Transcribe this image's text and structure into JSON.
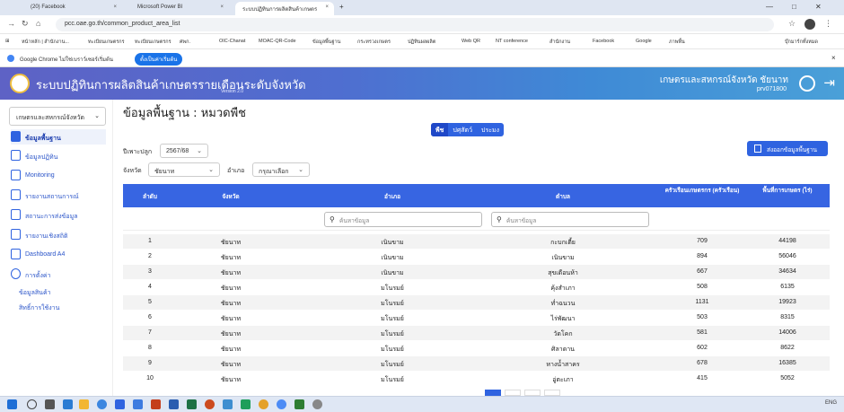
{
  "browser": {
    "tabs": [
      {
        "label": "(20) Facebook",
        "active": false
      },
      {
        "label": "Microsoft Power BI",
        "active": false
      },
      {
        "label": "ระบบปฏิทินการผลิตสินค้าเกษตร",
        "active": true
      }
    ],
    "new_tab": "+",
    "url": "pcc.oae.go.th/common_product_area_list",
    "bookmarks": [
      "หน้าหลัก | สำนักงาน...",
      "ทะเบียนเกษตรกร",
      "ทะเบียนเกษตรกร",
      "ศพก.",
      "OIC-Chanat",
      "MOAC-QR-Code",
      "ข้อมูลพื้นฐาน",
      "กระทรวงเกษตร",
      "ปฏิทินผลผลิต",
      "Web QR",
      "NT conference",
      "สำนักงาน",
      "Facebook",
      "Google",
      "ภาพพื้น"
    ],
    "all_bookmarks": "บุ๊กมาร์กทั้งหมด",
    "info_message": "Google Chrome ไม่ใช่เบราว์เซอร์เริ่มต้น",
    "info_button": "ตั้งเป็นค่าเริ่มต้น"
  },
  "app": {
    "title": "ระบบปฏิทินการผลิตสินค้าเกษตรรายเดือนระดับจังหวัด",
    "version": "Version 2.0",
    "org": "เกษตรและสหกรณ์จังหวัด ชัยนาท",
    "user_id": "prv071800"
  },
  "sidebar": {
    "org_select": "เกษตรและสหกรณ์จังหวัด",
    "items": [
      {
        "label": "ข้อมูลพื้นฐาน",
        "active": true
      },
      {
        "label": "ข้อมูลปฏิทิน",
        "active": false
      },
      {
        "label": "Monitoring",
        "active": false
      },
      {
        "label": "รายงานสถานการณ์",
        "active": false
      },
      {
        "label": "สถานะการส่งข้อมูล",
        "active": false
      },
      {
        "label": "รายงานเชิงสถิติ",
        "active": false
      },
      {
        "label": "Dashboard A4",
        "active": false
      },
      {
        "label": "การตั้งค่า",
        "active": false
      }
    ],
    "sub_items": [
      "ข้อมูลสินค้า",
      "สิทธิ์การใช้งาน"
    ]
  },
  "main": {
    "page_title": "ข้อมูลพื้นฐาน : หมวดพืช",
    "segments": [
      {
        "label": "พืช",
        "active": true
      },
      {
        "label": "ปศุสัตว์",
        "active": false
      },
      {
        "label": "ประมง",
        "active": false
      }
    ],
    "export_button": "ส่งออกข้อมูลพื้นฐาน",
    "filters": {
      "year_label": "ปีเพาะปลูก",
      "year_value": "2567/68",
      "province_label": "จังหวัด",
      "province_value": "ชัยนาท",
      "district_label": "อำเภอ",
      "district_value": "กรุณาเลือก"
    },
    "table": {
      "headers": [
        "ลำดับ",
        "จังหวัด",
        "อำเภอ",
        "ตำบล",
        "ครัวเรือนเกษตรกร (ครัวเรือน)",
        "พื้นที่การเกษตร (ไร่)"
      ],
      "search_placeholder": "ค้นหาข้อมูล",
      "rows": [
        [
          "1",
          "ชัยนาท",
          "เนินขาม",
          "กะบกเตี้ย",
          "709",
          "44198"
        ],
        [
          "2",
          "ชัยนาท",
          "เนินขาม",
          "เนินขาม",
          "894",
          "56046"
        ],
        [
          "3",
          "ชัยนาท",
          "เนินขาม",
          "สุขเดือนห้า",
          "667",
          "34634"
        ],
        [
          "4",
          "ชัยนาท",
          "มโนรมย์",
          "คุ้งสำเภา",
          "508",
          "6135"
        ],
        [
          "5",
          "ชัยนาท",
          "มโนรมย์",
          "ท่ำฉนวน",
          "1131",
          "19923"
        ],
        [
          "6",
          "ชัยนาท",
          "มโนรมย์",
          "ไร่พัฒนา",
          "503",
          "8315"
        ],
        [
          "7",
          "ชัยนาท",
          "มโนรมย์",
          "วัดโคก",
          "581",
          "14006"
        ],
        [
          "8",
          "ชัยนาท",
          "มโนรมย์",
          "ศิลาดาน",
          "602",
          "8622"
        ],
        [
          "9",
          "ชัยนาท",
          "มโนรมย์",
          "หางน้ำสาคร",
          "678",
          "16385"
        ],
        [
          "10",
          "ชัยนาท",
          "มโนรมย์",
          "อู่ตะเภา",
          "415",
          "5052"
        ]
      ]
    }
  },
  "taskbar": {
    "tray_text": "ENG",
    "colors": {
      "accent": "#2f63e0",
      "header_start": "#5e62c5",
      "header_end": "#4aa0d8"
    }
  }
}
